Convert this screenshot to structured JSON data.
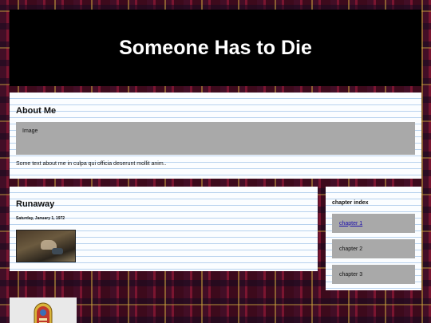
{
  "header": {
    "title": "Someone Has to Die"
  },
  "about": {
    "heading": "About Me",
    "image_placeholder": "Image",
    "text": "Some text about me in culpa qui officia deserunt mollit anim.."
  },
  "post": {
    "title": "Runaway",
    "date": "Saturday, January 1, 1972"
  },
  "sidebar": {
    "heading": "chapter index",
    "chapters": [
      {
        "label": "chapter 1"
      },
      {
        "label": "chapter 2"
      },
      {
        "label": "chapter 3"
      }
    ]
  },
  "icons": {
    "badge": "jukebox-badge-icon"
  },
  "colors": {
    "header_bg": "#000000",
    "placeholder": "#a9a9a9",
    "link": "#1a0dab"
  }
}
